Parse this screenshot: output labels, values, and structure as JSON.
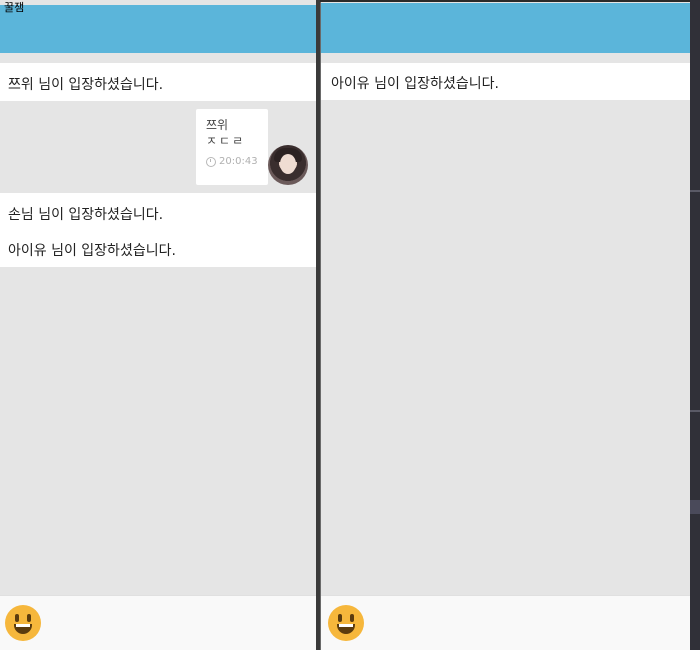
{
  "window": {
    "title": "꿀잼"
  },
  "left_pane": {
    "system_notices_top": [
      "쯔위 님이 입장하셨습니다."
    ],
    "message": {
      "sender": "쯔위",
      "text": "ㅈㄷㄹ",
      "time": "20:0:43"
    },
    "system_notices_bottom": [
      "손님 님이 입장하셨습니다.",
      "아이유 님이 입장하셨습니다."
    ]
  },
  "right_pane": {
    "system_notices": [
      "아이유 님이 입장하셨습니다."
    ]
  },
  "icons": {
    "emoji": "smiley-emoji-icon",
    "clock": "clock-icon",
    "avatar": "profile-avatar"
  },
  "colors": {
    "header": "#5bb5da",
    "chat_bg": "#e5e5e5",
    "notice_bg": "#ffffff",
    "emoji": "#f6b73c"
  }
}
